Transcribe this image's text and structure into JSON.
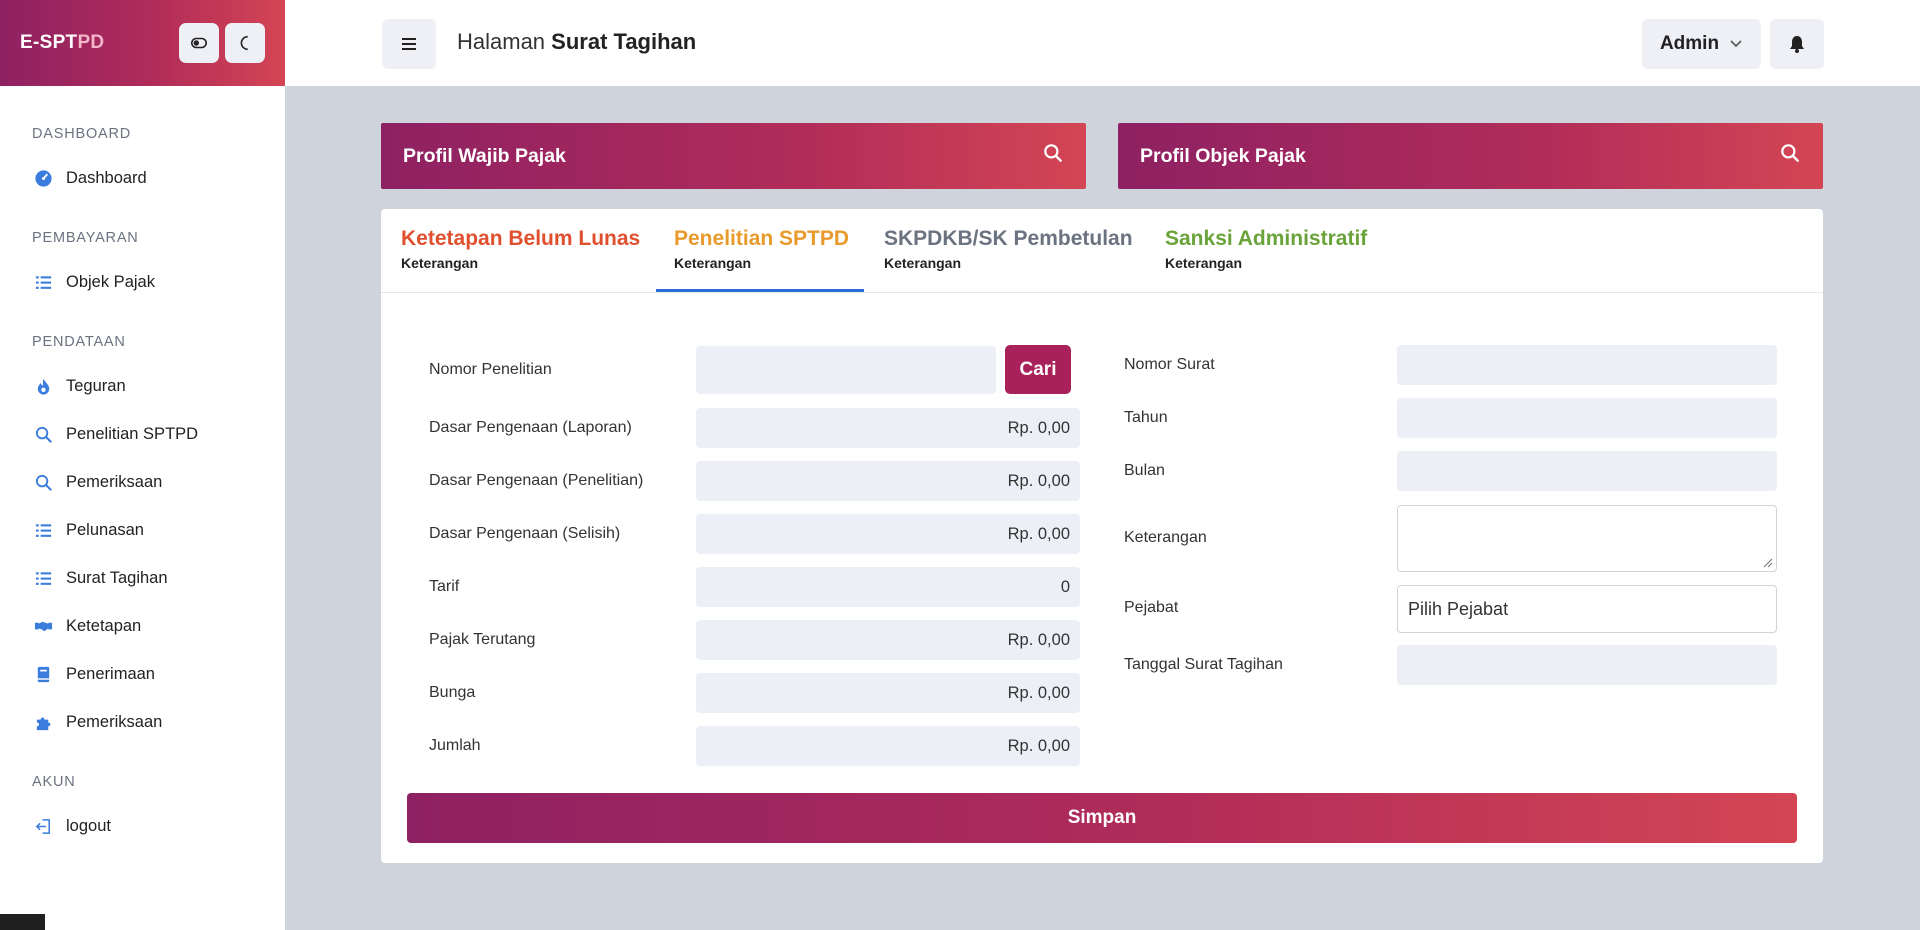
{
  "brand": {
    "name_bold": "E-SPT",
    "name_light": "PD"
  },
  "sidebar": {
    "sections": [
      {
        "title": "DASHBOARD",
        "items": [
          {
            "label": "Dashboard",
            "icon": "dashboard-icon"
          }
        ]
      },
      {
        "title": "PEMBAYARAN",
        "items": [
          {
            "label": "Objek Pajak",
            "icon": "list-icon"
          }
        ]
      },
      {
        "title": "PENDATAAN",
        "items": [
          {
            "label": "Teguran",
            "icon": "fire-icon"
          },
          {
            "label": "Penelitian SPTPD",
            "icon": "search-icon"
          },
          {
            "label": "Pemeriksaan",
            "icon": "search-icon"
          },
          {
            "label": "Pelunasan",
            "icon": "list-icon"
          },
          {
            "label": "Surat Tagihan",
            "icon": "list-icon"
          },
          {
            "label": "Ketetapan",
            "icon": "handshake-icon"
          },
          {
            "label": "Penerimaan",
            "icon": "book-icon"
          },
          {
            "label": "Pemeriksaan",
            "icon": "puzzle-icon"
          }
        ]
      },
      {
        "title": "AKUN",
        "items": [
          {
            "label": "logout",
            "icon": "logout-icon"
          }
        ]
      }
    ]
  },
  "header": {
    "title_prefix": "Halaman",
    "title_bold": "Surat Tagihan",
    "user_label": "Admin"
  },
  "profiles": {
    "wajib_pajak": "Profil Wajib Pajak",
    "objek_pajak": "Profil Objek Pajak"
  },
  "tabs": [
    {
      "label": "Ketetapan Belum Lunas",
      "sub": "Keterangan",
      "color": "#e0502e"
    },
    {
      "label": "Penelitian SPTPD",
      "sub": "Keterangan",
      "color": "#e89b2c"
    },
    {
      "label": "SKPDKB/SK Pembetulan",
      "sub": "Keterangan",
      "color": "#6b7280"
    },
    {
      "label": "Sanksi Administratif",
      "sub": "Keterangan",
      "color": "#6aa33a"
    }
  ],
  "active_tab": 1,
  "form_left": {
    "nomor_penelitian": {
      "label": "Nomor Penelitian",
      "value": ""
    },
    "cari_label": "Cari",
    "rows": [
      {
        "label": "Dasar Pengenaan (Laporan)",
        "value": "Rp. 0,00"
      },
      {
        "label": "Dasar Pengenaan (Penelitian)",
        "value": "Rp. 0,00"
      },
      {
        "label": "Dasar Pengenaan (Selisih)",
        "value": "Rp. 0,00"
      },
      {
        "label": "Tarif",
        "value": "0"
      },
      {
        "label": "Pajak Terutang",
        "value": "Rp. 0,00"
      },
      {
        "label": "Bunga",
        "value": "Rp. 0,00"
      },
      {
        "label": "Jumlah",
        "value": "Rp. 0,00"
      }
    ]
  },
  "form_right": {
    "nomor_surat": {
      "label": "Nomor Surat",
      "value": ""
    },
    "tahun": {
      "label": "Tahun",
      "value": ""
    },
    "bulan": {
      "label": "Bulan",
      "value": ""
    },
    "keterangan": {
      "label": "Keterangan",
      "value": ""
    },
    "pejabat": {
      "label": "Pejabat",
      "value": "Pilih Pejabat"
    },
    "tanggal": {
      "label": "Tanggal Surat Tagihan",
      "value": ""
    }
  },
  "submit_label": "Simpan"
}
